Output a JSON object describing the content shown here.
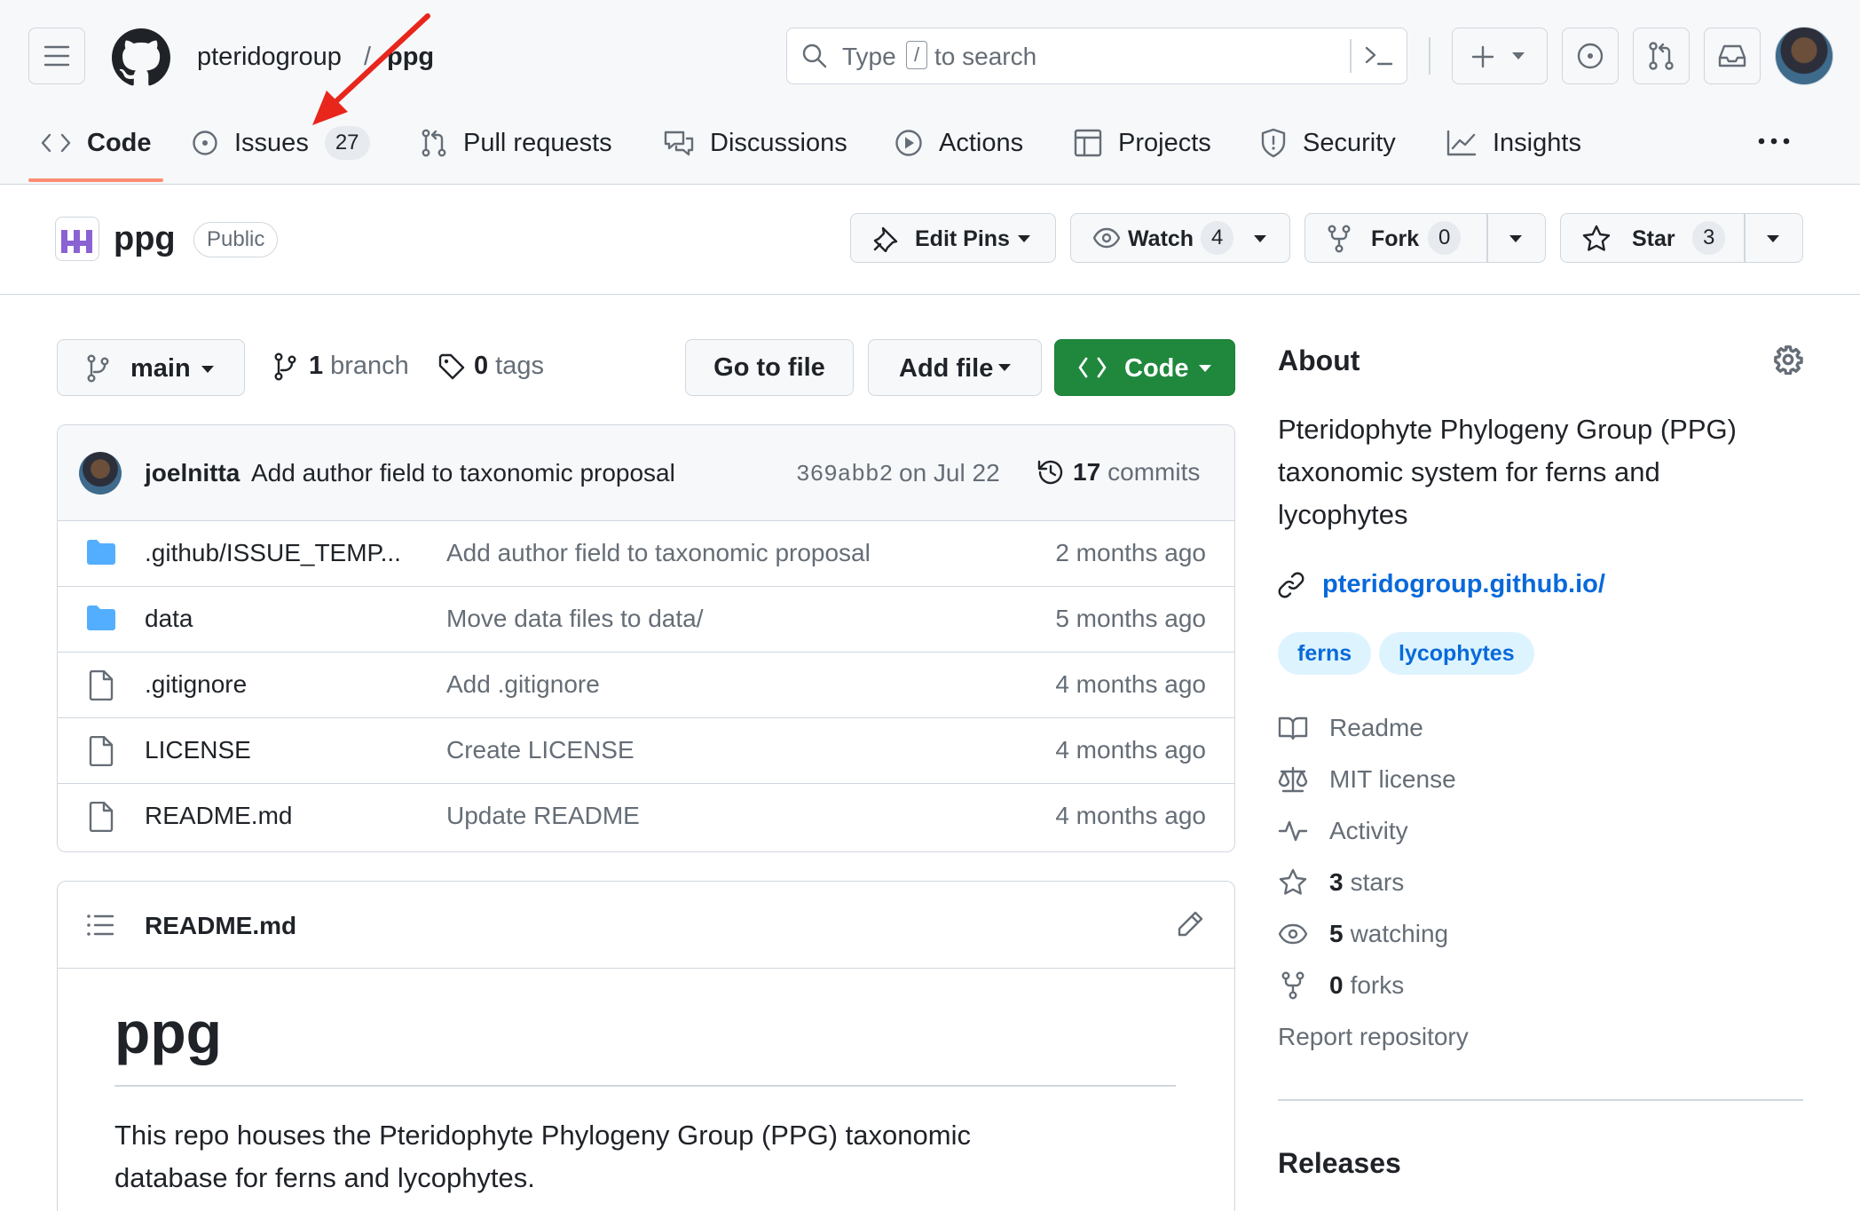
{
  "header": {
    "org": "pteridogroup",
    "separator": "/",
    "repo": "ppg",
    "search": {
      "prefix": "Type",
      "key": "/",
      "suffix": "to search"
    }
  },
  "tabs": [
    {
      "label": "Code",
      "active": true
    },
    {
      "label": "Issues",
      "count": "27"
    },
    {
      "label": "Pull requests"
    },
    {
      "label": "Discussions"
    },
    {
      "label": "Actions"
    },
    {
      "label": "Projects"
    },
    {
      "label": "Security"
    },
    {
      "label": "Insights"
    }
  ],
  "repo_header": {
    "name": "ppg",
    "visibility": "Public",
    "edit_pins": "Edit Pins",
    "watch": {
      "label": "Watch",
      "count": "4"
    },
    "fork": {
      "label": "Fork",
      "count": "0"
    },
    "star": {
      "label": "Star",
      "count": "3"
    }
  },
  "toolbar": {
    "branch": "main",
    "branches_count": "1",
    "branches_label": "branch",
    "tags_count": "0",
    "tags_label": "tags",
    "go_to_file": "Go to file",
    "add_file": "Add file",
    "code": "Code"
  },
  "latest_commit": {
    "author": "joelnitta",
    "message": "Add author field to taxonomic proposal",
    "sha": "369abb2",
    "date": "on Jul 22",
    "commits_count": "17",
    "commits_label": "commits"
  },
  "files": [
    {
      "type": "folder",
      "name": ".github/ISSUE_TEMP...",
      "message": "Add author field to taxonomic proposal",
      "age": "2 months ago"
    },
    {
      "type": "folder",
      "name": "data",
      "message": "Move data files to data/",
      "age": "5 months ago"
    },
    {
      "type": "file",
      "name": ".gitignore",
      "message": "Add .gitignore",
      "age": "4 months ago"
    },
    {
      "type": "file",
      "name": "LICENSE",
      "message": "Create LICENSE",
      "age": "4 months ago"
    },
    {
      "type": "file",
      "name": "README.md",
      "message": "Update README",
      "age": "4 months ago"
    }
  ],
  "readme": {
    "filename": "README.md",
    "heading": "ppg",
    "body_line1": "This repo houses the Pteridophyte Phylogeny Group (PPG) taxonomic",
    "body_line2": "database for ferns and lycophytes."
  },
  "about": {
    "title": "About",
    "description_lines": [
      "Pteridophyte Phylogeny Group (PPG)",
      "taxonomic system for ferns and",
      "lycophytes"
    ],
    "link": "pteridogroup.github.io/",
    "topics": [
      "ferns",
      "lycophytes"
    ],
    "readme": "Readme",
    "license": "MIT license",
    "activity": "Activity",
    "stars_count": "3",
    "stars_label": "stars",
    "watching_count": "5",
    "watching_label": "watching",
    "forks_count": "0",
    "forks_label": "forks",
    "report": "Report repository",
    "releases_title": "Releases"
  },
  "colors": {
    "accent": "#0969da",
    "green_button": "#1f883d",
    "folder": "#54aeff",
    "annotation_arrow": "#e8261c",
    "tab_underline": "#fd8c73"
  }
}
